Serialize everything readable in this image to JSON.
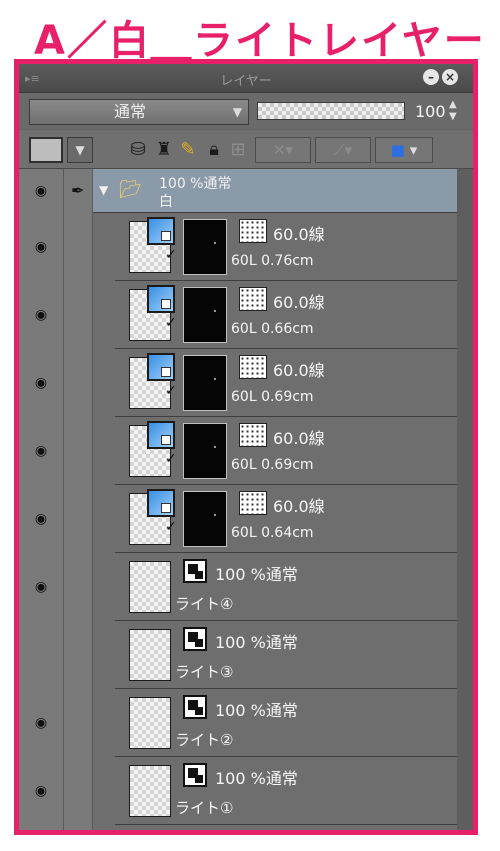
{
  "heading": "A／白＿ライトレイヤー",
  "panel": {
    "title": "レイヤー",
    "min_icon": "minimize-icon",
    "close_icon": "close-icon",
    "blend_mode": "通常",
    "opacity_value": "100"
  },
  "toolbar": {
    "icons": [
      "layer-color-dropdown-icon",
      "ruler-icon",
      "pen-icon",
      "color-pencil-icon",
      "lock-icon",
      "lock-transparent-icon",
      "clip-icon",
      "reference-icon",
      "color-swap-icon"
    ]
  },
  "group": {
    "meta": "100 %通常",
    "name": "白"
  },
  "tone_layers": [
    {
      "label": "60.0線",
      "size": "60L 0.76cm"
    },
    {
      "label": "60.0線",
      "size": "60L 0.66cm"
    },
    {
      "label": "60.0線",
      "size": "60L 0.69cm"
    },
    {
      "label": "60.0線",
      "size": "60L 0.69cm"
    },
    {
      "label": "60.0線",
      "size": "60L 0.64cm"
    }
  ],
  "light_layers": [
    {
      "meta": "100 %通常",
      "name": "ライト④"
    },
    {
      "meta": "100 %通常",
      "name": "ライト③"
    },
    {
      "meta": "100 %通常",
      "name": "ライト②"
    },
    {
      "meta": "100 %通常",
      "name": "ライト①"
    }
  ]
}
